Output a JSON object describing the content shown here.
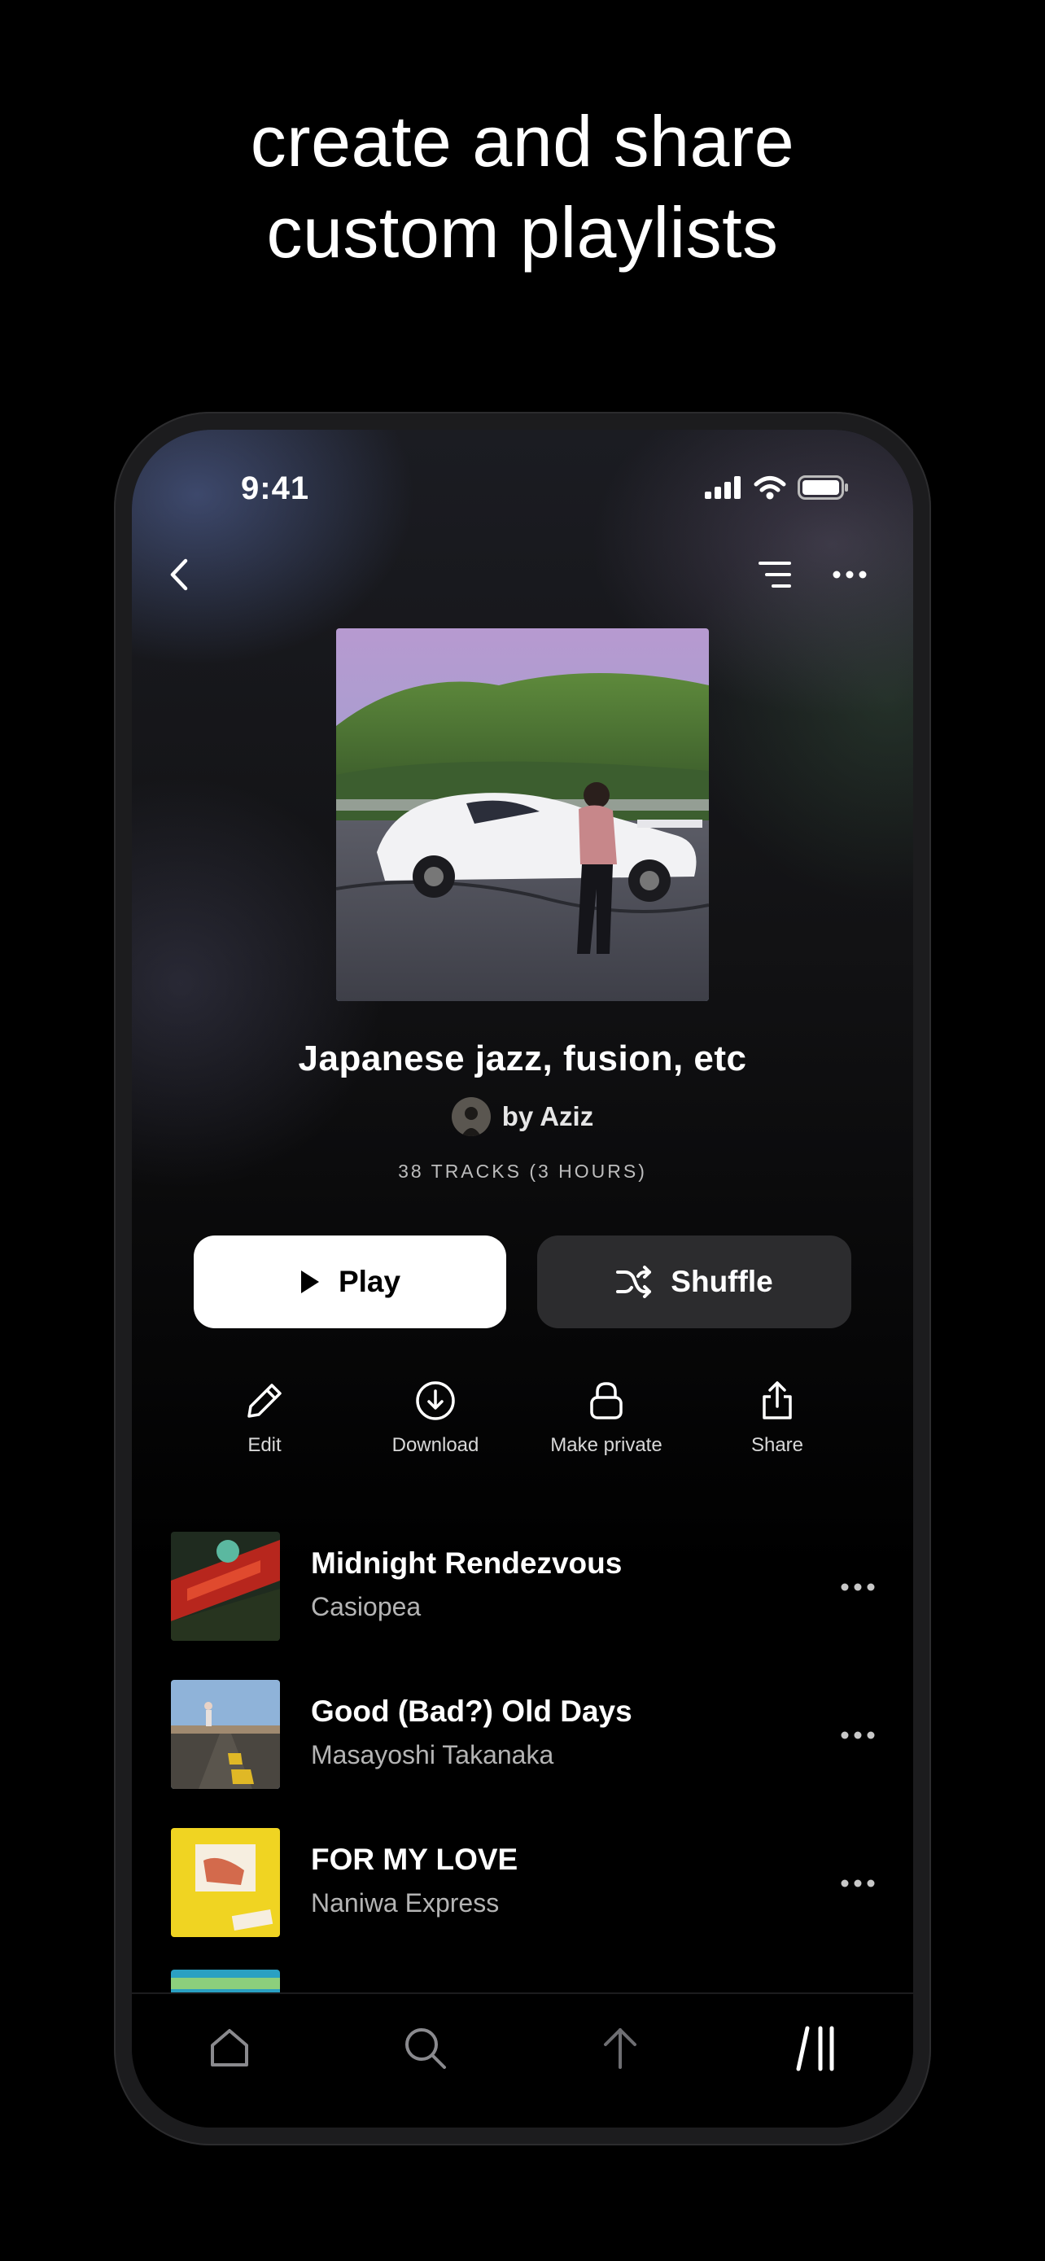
{
  "promo": {
    "line1": "create and share",
    "line2": "custom playlists"
  },
  "status_bar": {
    "time": "9:41",
    "icons": [
      "cellular-signal-icon",
      "wifi-icon",
      "battery-icon"
    ]
  },
  "nav": {
    "icons": [
      "chevron-left-icon",
      "sort-icon",
      "more-horizontal-icon"
    ]
  },
  "playlist": {
    "title": "Japanese jazz, fusion, etc",
    "owner": "by Aziz",
    "meta": "38 TRACKS (3 HOURS)"
  },
  "buttons": {
    "play": "Play",
    "shuffle": "Shuffle"
  },
  "actions": [
    {
      "label": "Edit",
      "icon": "pencil-icon"
    },
    {
      "label": "Download",
      "icon": "download-icon"
    },
    {
      "label": "Make private",
      "icon": "lock-icon"
    },
    {
      "label": "Share",
      "icon": "share-icon"
    }
  ],
  "tracks": [
    {
      "title": "Midnight Rendezvous",
      "artist": "Casiopea"
    },
    {
      "title": "Good (Bad?) Old Days",
      "artist": "Masayoshi Takanaka"
    },
    {
      "title": "FOR MY LOVE",
      "artist": "Naniwa Express"
    }
  ],
  "tabbar": {
    "icons": [
      "home-icon",
      "search-icon",
      "upload-icon",
      "library-icon"
    ]
  },
  "colors": {
    "background": "#000000",
    "play_button": "#ffffff",
    "shuffle_button": "#2c2c2e",
    "secondary_text": "#b4b4b4"
  }
}
